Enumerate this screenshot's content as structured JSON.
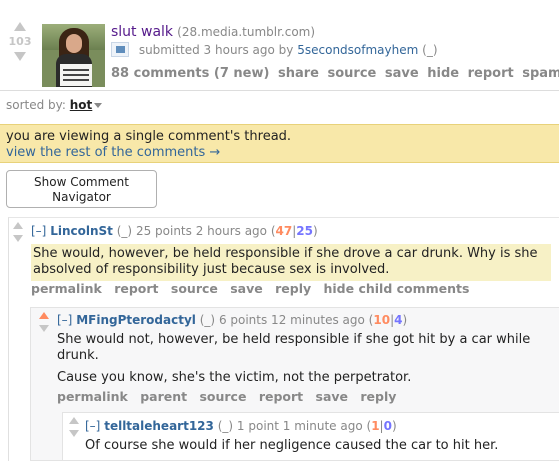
{
  "link": {
    "score": "103",
    "title": "slut walk",
    "domain": "(28.media.tumblr.com)",
    "submitted_prefix": "submitted 3 hours ago by",
    "author": "5secondsofmayhem",
    "author_flair": "(_)",
    "buttons": [
      "88 comments (7 new)",
      "share",
      "source",
      "save",
      "hide",
      "report",
      "spam"
    ]
  },
  "sort": {
    "label": "sorted by:",
    "value": "hot"
  },
  "notice": {
    "text": "you are viewing a single comment's thread.",
    "link": "view the rest of the comments →"
  },
  "navigator": {
    "label_line1": "Show Comment",
    "label_line2": "Navigator"
  },
  "comments": [
    {
      "expand": "[–]",
      "author": "LincolnSt",
      "flair": "(_)",
      "meta": "25 points 2 hours ago",
      "up": "47",
      "down": "25",
      "body": [
        "She would, however, be held responsible if she drove a car drunk. Why is she absolved of responsibility just because sex is involved."
      ],
      "buttons": [
        "permalink",
        "report",
        "source",
        "save",
        "reply",
        "hide child comments"
      ],
      "highlight": "#f7f1c6"
    },
    {
      "expand": "[–]",
      "author": "MFingPterodactyl",
      "flair": "(_)",
      "meta": "6 points 12 minutes ago",
      "up": "10",
      "down": "4",
      "body": [
        "She would not, however, be held responsible if she got hit by a car while drunk.",
        "Cause you know, she's the victim, not the perpetrator."
      ],
      "buttons": [
        "permalink",
        "parent",
        "source",
        "report",
        "save",
        "reply"
      ]
    },
    {
      "expand": "[–]",
      "author": "telltaleheart123",
      "flair": "(_)",
      "meta": "1 point 1 minute ago",
      "up": "1",
      "down": "0",
      "body": [
        "Of course she would if her negligence caused the car to hit her."
      ]
    }
  ],
  "colors": {
    "upvote": "#ff8b60",
    "downvote": "#7575ff",
    "link": "#336699",
    "notice_bg": "#f8e8a9"
  }
}
